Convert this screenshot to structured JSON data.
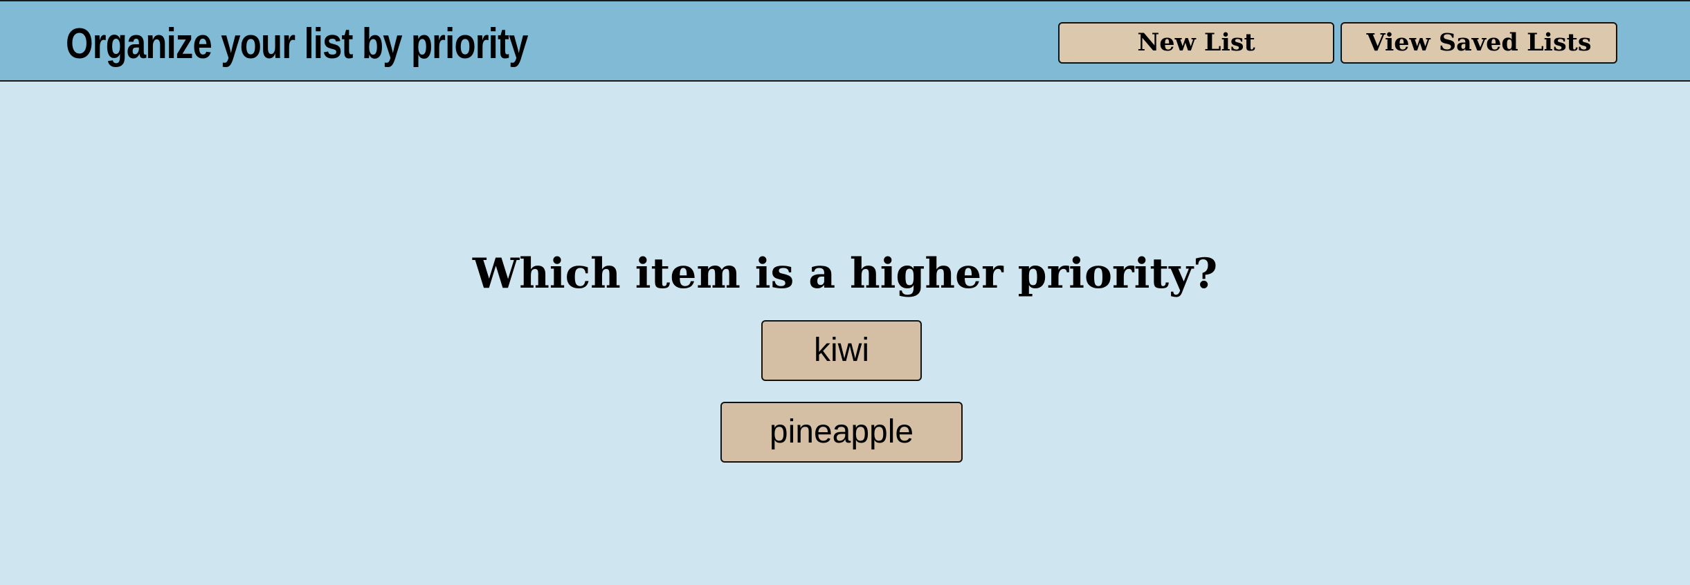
{
  "header": {
    "title": "Organize your list by priority",
    "buttons": {
      "new_list": "New List",
      "view_saved": "View Saved Lists"
    }
  },
  "main": {
    "question": "Which item is a higher priority?",
    "choices": [
      "kiwi",
      "pineapple"
    ]
  },
  "colors": {
    "header_bg": "#80bad5",
    "page_bg": "#cfe5ef",
    "nav_button_bg": "#dcc8ad",
    "choice_button_bg": "#d4bfa4"
  }
}
